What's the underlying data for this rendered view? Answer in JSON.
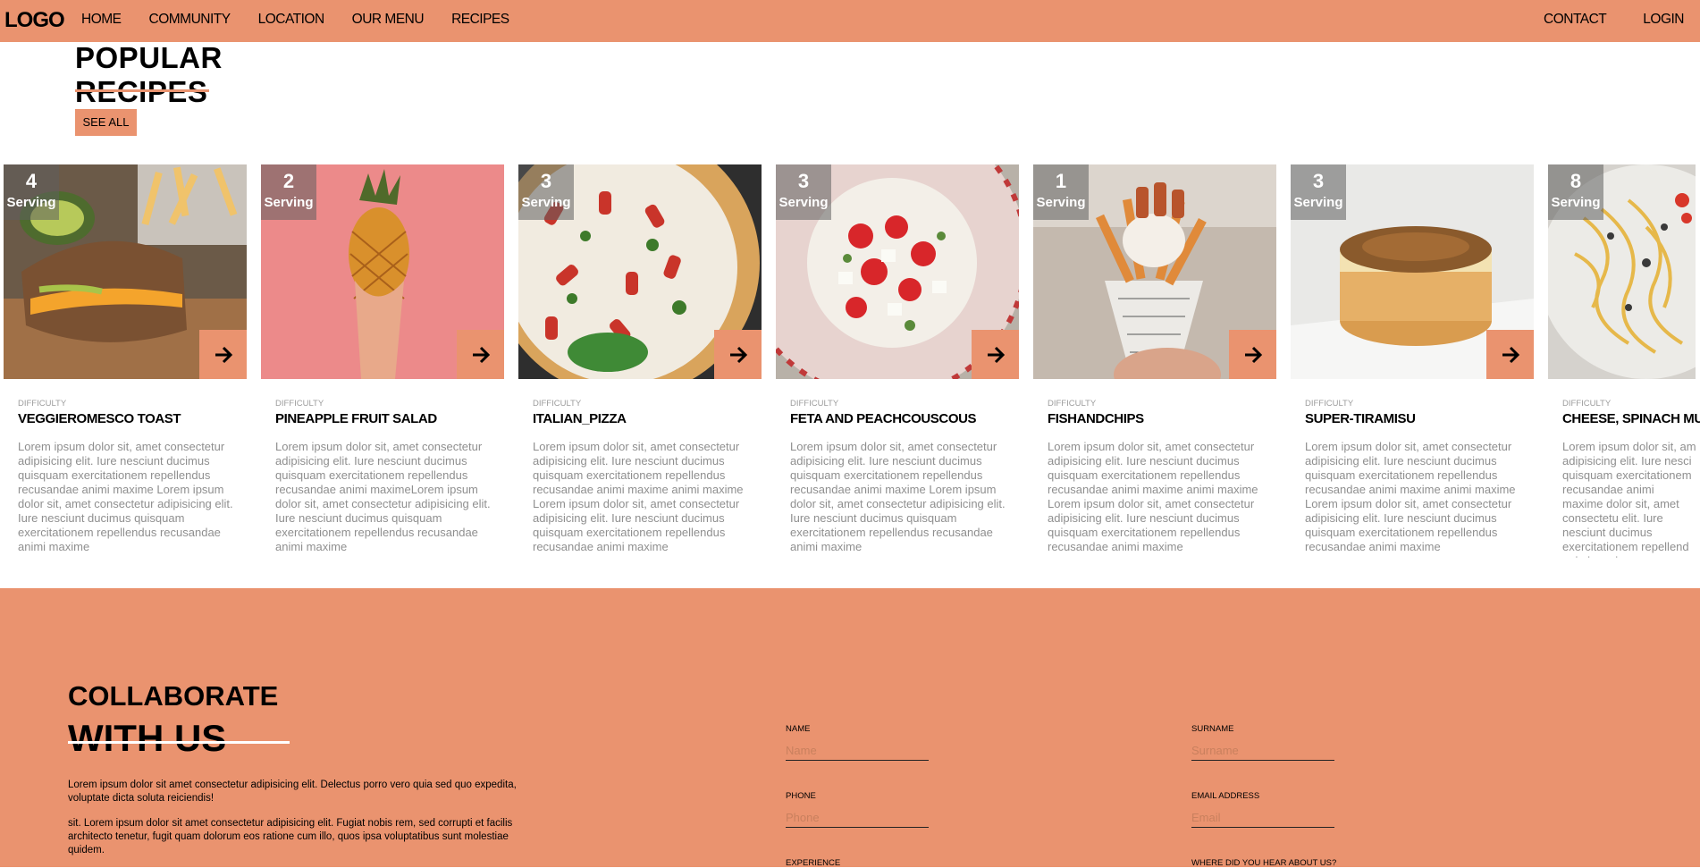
{
  "nav": {
    "logo": "LOGO",
    "links": [
      "HOME",
      "COMMUNITY",
      "LOCATION",
      "OUR MENU",
      "RECIPES"
    ],
    "right": [
      "CONTACT",
      "LOGIN"
    ]
  },
  "popular": {
    "title_line1": "POPULAR",
    "title_line2": "RECIPES",
    "see_all": "SEE ALL"
  },
  "cards": [
    {
      "serving_count": "4",
      "serving_label": "Serving",
      "difficulty_label": "DIFFICULTY",
      "name": "VEGGIEROMESCO TOAST",
      "desc": "Lorem ipsum dolor sit, amet consectetur adipisicing elit. Iure nesciunt ducimus quisquam exercitationem repellendus recusandae animi maxime Lorem ipsum dolor sit, amet consectetur adipisicing elit. Iure nesciunt ducimus quisquam exercitationem repellendus recusandae animi maxime"
    },
    {
      "serving_count": "2",
      "serving_label": "Serving",
      "difficulty_label": "DIFFICULTY",
      "name": "PINEAPPLE FRUIT SALAD",
      "desc": "Lorem ipsum dolor sit, amet consectetur adipisicing elit. Iure nesciunt ducimus quisquam exercitationem repellendus recusandae animi maximeLorem ipsum dolor sit, amet consectetur adipisicing elit. Iure nesciunt ducimus quisquam exercitationem repellendus recusandae animi maxime"
    },
    {
      "serving_count": "3",
      "serving_label": "Serving",
      "difficulty_label": "DIFFICULTY",
      "name": "ITALIAN_PIZZA",
      "desc": "Lorem ipsum dolor sit, amet consectetur adipisicing elit. Iure nesciunt ducimus quisquam exercitationem repellendus recusandae animi maxime animi maxime Lorem ipsum dolor sit, amet consectetur adipisicing elit. Iure nesciunt ducimus quisquam exercitationem repellendus recusandae animi maxime"
    },
    {
      "serving_count": "3",
      "serving_label": "Serving",
      "difficulty_label": "DIFFICULTY",
      "name": "FETA AND PEACHCOUSCOUS",
      "desc": "Lorem ipsum dolor sit, amet consectetur adipisicing elit. Iure nesciunt ducimus quisquam exercitationem repellendus recusandae animi maxime Lorem ipsum dolor sit, amet consectetur adipisicing elit. Iure nesciunt ducimus quisquam exercitationem repellendus recusandae animi maxime"
    },
    {
      "serving_count": "1",
      "serving_label": "Serving",
      "difficulty_label": "DIFFICULTY",
      "name": "FISHANDCHIPS",
      "desc": "Lorem ipsum dolor sit, amet consectetur adipisicing elit. Iure nesciunt ducimus quisquam exercitationem repellendus recusandae animi maxime animi maxime Lorem ipsum dolor sit, amet consectetur adipisicing elit. Iure nesciunt ducimus quisquam exercitationem repellendus recusandae animi maxime"
    },
    {
      "serving_count": "3",
      "serving_label": "Serving",
      "difficulty_label": "DIFFICULTY",
      "name": "SUPER-TIRAMISU",
      "desc": "Lorem ipsum dolor sit, amet consectetur adipisicing elit. Iure nesciunt ducimus quisquam exercitationem repellendus recusandae animi maxime animi maxime Lorem ipsum dolor sit, amet consectetur adipisicing elit. Iure nesciunt ducimus quisquam exercitationem repellendus recusandae animi maxime"
    },
    {
      "serving_count": "8",
      "serving_label": "Serving",
      "difficulty_label": "DIFFICULTY",
      "name": "CHEESE, SPINACH MU",
      "desc": "Lorem ipsum dolor sit, am adipisicing elit. Iure nesci quisquam exercitationem recusandae animi maxime dolor sit, amet consectetu elit. Iure nesciunt ducimus exercitationem repellend animi maxime"
    }
  ],
  "collaborate": {
    "title_line1": "COLLABORATE",
    "title_line2": "WITH US",
    "para1": "Lorem ipsum dolor sit amet consectetur adipisicing elit. Delectus porro vero quia sed quo expedita, voluptate dicta soluta reiciendis!",
    "para2": "sit. Lorem ipsum dolor sit amet consectetur adipisicing elit. Fugiat nobis rem, sed corrupti et facilis architecto tenetur, fugit quam dolorum eos ratione cum illo, quos ipsa voluptatibus sunt molestiae quidem.",
    "form": {
      "name_label": "NAME",
      "name_placeholder": "Name",
      "surname_label": "SURNAME",
      "surname_placeholder": "Surname",
      "phone_label": "PHONE",
      "phone_placeholder": "Phone",
      "email_label": "EMAIL ADDRESS",
      "email_placeholder": "Email",
      "experience_label": "EXPERIENCE",
      "where_label": "WHERE DID YOU HEAR ABOUT US?"
    }
  },
  "colors": {
    "accent": "#ea936f",
    "text": "#000000",
    "muted": "#8f8f8f"
  },
  "icons": {
    "card_link": "arrow-right-icon"
  }
}
